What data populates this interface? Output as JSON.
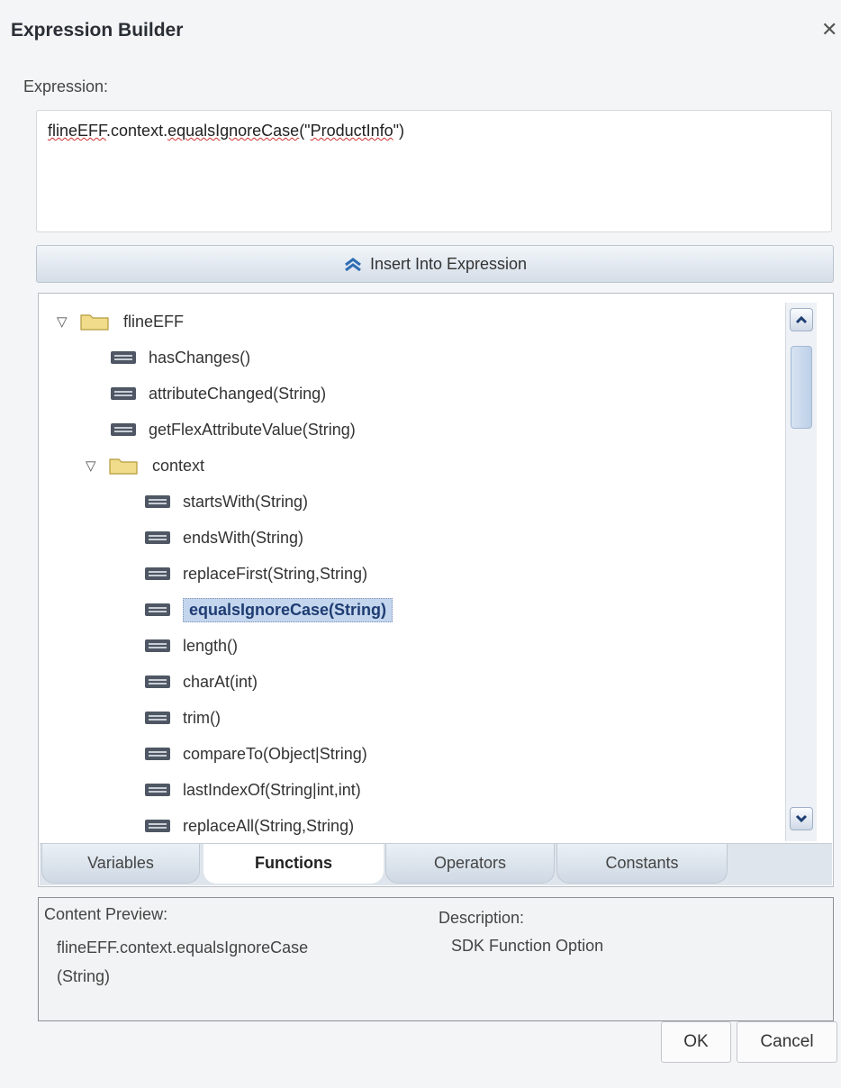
{
  "dialog": {
    "title": "Expression Builder",
    "close_glyph": "✕"
  },
  "expression": {
    "label": "Expression:",
    "value_parts": [
      "flineEFF",
      ".context.",
      "equalsIgnoreCase",
      "(\"",
      "ProductInfo",
      "\")"
    ]
  },
  "insert_button": {
    "label": "Insert Into Expression",
    "icon": "double-chevron-up-icon"
  },
  "tree": {
    "items": [
      {
        "label": "flineEFF",
        "type": "folder",
        "expanded": true,
        "level": 0
      },
      {
        "label": "hasChanges()",
        "type": "function",
        "level": 1
      },
      {
        "label": "attributeChanged(String)",
        "type": "function",
        "level": 1
      },
      {
        "label": "getFlexAttributeValue(String)",
        "type": "function",
        "level": 1
      },
      {
        "label": "context",
        "type": "folder",
        "expanded": true,
        "level": 1
      },
      {
        "label": "startsWith(String)",
        "type": "function",
        "level": 2
      },
      {
        "label": "endsWith(String)",
        "type": "function",
        "level": 2
      },
      {
        "label": "replaceFirst(String,String)",
        "type": "function",
        "level": 2
      },
      {
        "label": "equalsIgnoreCase(String)",
        "type": "function",
        "level": 2,
        "selected": true
      },
      {
        "label": "length()",
        "type": "function",
        "level": 2
      },
      {
        "label": "charAt(int)",
        "type": "function",
        "level": 2
      },
      {
        "label": "trim()",
        "type": "function",
        "level": 2
      },
      {
        "label": "compareTo(Object|String)",
        "type": "function",
        "level": 2
      },
      {
        "label": "lastIndexOf(String|int,int)",
        "type": "function",
        "level": 2
      },
      {
        "label": "replaceAll(String,String)",
        "type": "function",
        "level": 2
      }
    ]
  },
  "tabs": [
    {
      "label": "Variables",
      "active": false
    },
    {
      "label": "Functions",
      "active": true
    },
    {
      "label": "Operators",
      "active": false
    },
    {
      "label": "Constants",
      "active": false
    }
  ],
  "preview": {
    "content_label": "Content Preview:",
    "content_line1": "flineEFF.context.equalsIgnoreCase",
    "content_line2": "(String)",
    "description_label": "Description:",
    "description_value": "SDK Function Option"
  },
  "buttons": {
    "ok": "OK",
    "cancel": "Cancel"
  },
  "colors": {
    "selection": "#c4d6ee",
    "folder": "#f0dc8a",
    "insert_icon": "#2f6db5"
  }
}
